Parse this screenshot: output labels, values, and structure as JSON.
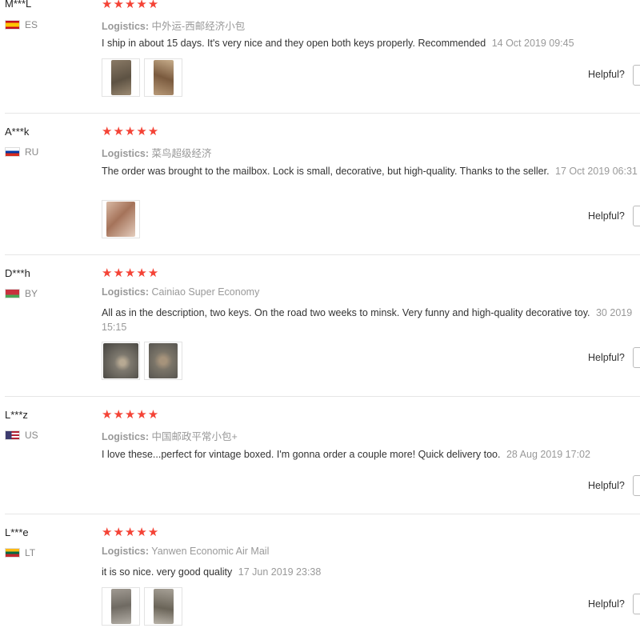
{
  "reviews": [
    {
      "user": "M***L",
      "country": "ES",
      "flag_colors": [
        "#c60b1e",
        "#ffc400",
        "#c60b1e"
      ],
      "rating": "★★★★★",
      "logistics_label": "Logistics:",
      "logistics": "中外运-西邮经济小包",
      "text": "I ship in about 15 days. It's very nice and they open both keys properly. Recommended",
      "date": "14 Oct 2019 09:45",
      "photos": [
        "photo-1",
        "photo-2"
      ],
      "helpful": "Helpful?"
    },
    {
      "user": "A***k",
      "country": "RU",
      "flag_colors": [
        "#ffffff",
        "#0039a6",
        "#d52b1e"
      ],
      "rating": "★★★★★",
      "logistics_label": "Logistics:",
      "logistics": "菜鸟超级经济",
      "text": "The order was brought to the mailbox. Lock is small, decorative, but high-quality. Thanks to the seller.",
      "date": "17 Oct 2019 06:31",
      "photos": [
        "photo-1"
      ],
      "helpful": "Helpful?"
    },
    {
      "user": "D***h",
      "country": "BY",
      "flag_colors": [
        "#c8313e",
        "#c8313e",
        "#4aa657"
      ],
      "rating": "★★★★★",
      "logistics_label": "Logistics:",
      "logistics": "Cainiao Super Economy",
      "text": "All as in the description, two keys. On the road two weeks to minsk. Very funny and high-quality decorative toy.",
      "date": "30 2019 15:15",
      "photos": [
        "photo-1",
        "photo-2"
      ],
      "helpful": "Helpful?"
    },
    {
      "user": "L***z",
      "country": "US",
      "flag_colors": [
        "#b22234",
        "#ffffff",
        "#3c3b6e"
      ],
      "rating": "★★★★★",
      "logistics_label": "Logistics:",
      "logistics": "中国邮政平常小包+",
      "text": "I love these...perfect for vintage boxed. I'm gonna order a couple more! Quick delivery too.",
      "date": "28 Aug 2019 17:02",
      "photos": [],
      "helpful": "Helpful?"
    },
    {
      "user": "L***e",
      "country": "LT",
      "flag_colors": [
        "#fdb913",
        "#006a44",
        "#c1272d"
      ],
      "rating": "★★★★★",
      "logistics_label": "Logistics:",
      "logistics": "Yanwen Economic Air Mail",
      "text": "it is so nice. very good quality",
      "date": "17 Jun 2019 23:38",
      "photos": [
        "photo-1",
        "photo-2"
      ],
      "helpful": "Helpful?"
    }
  ]
}
